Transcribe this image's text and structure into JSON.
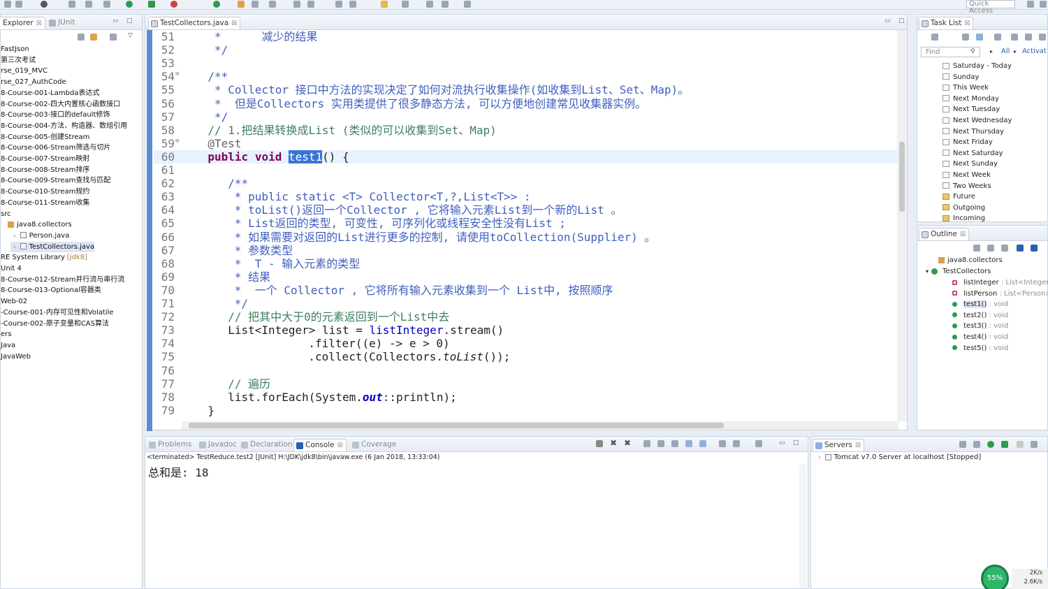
{
  "toolbar": {
    "quick_access": "Quick Access"
  },
  "explorer": {
    "tabs": [
      {
        "label": "Explorer",
        "close": "☒"
      },
      {
        "label": "JUnit"
      }
    ],
    "rows": [
      "FastJson",
      "第三次考试",
      "rse_019_MVC",
      "rse_027_AuthCode",
      "8-Course-001-Lambda表达式",
      "8-Course-002-四大内置核心函数接口",
      "8-Course-003-接口的default修饰",
      "8-Course-004-方法、构造器、数组引用",
      "8-Course-005-创建Stream",
      "8-Course-006-Stream筛选与切片",
      "8-Course-007-Stream映射",
      "8-Course-008-Stream排序",
      "8-Course-009-Stream查找与匹配",
      "8-Course-010-Stream规约",
      "8-Course-011-Stream收集",
      "src",
      "java8.collectors",
      "Person.java",
      "TestCollectors.java",
      "RE System Library",
      "Unit 4",
      "8-Course-012-Stream并行流与串行流",
      "8-Course-013-Optional容器类",
      "Web-02",
      "-Course-001-内存可见性和Volatile",
      "-Course-002-原子变量和CAS算法",
      "ers",
      "Java",
      "JavaWeb"
    ],
    "jdk_suffix": "[jdk8]"
  },
  "editor": {
    "tab_label": "TestCollectors.java",
    "tab_close": "☒",
    "lines": [
      {
        "n": "51",
        "t": "*      减少的结果",
        "cls": "jd",
        "ind": 0
      },
      {
        "n": "52",
        "t": "*/",
        "cls": "jd",
        "ind": 0
      },
      {
        "n": "53",
        "t": "",
        "cls": "",
        "ind": 0
      },
      {
        "n": "54",
        "t": "/**",
        "cls": "jd",
        "ind": -1
      },
      {
        "n": "55",
        "t": "* Collector 接口中方法的实现决定了如何对流执行收集操作(如收集到List、Set、Map)。",
        "cls": "jd",
        "ind": 0
      },
      {
        "n": "56",
        "t": "*  但是Collectors 实用类提供了很多静态方法, 可以方便地创建常见收集器实例。",
        "cls": "jd",
        "ind": 0
      },
      {
        "n": "57",
        "t": "*/",
        "cls": "jd",
        "ind": 0
      },
      {
        "n": "58",
        "t": "// 1.把结果转换成List (类似的可以收集到Set、Map)",
        "cls": "cm",
        "ind": -1
      },
      {
        "n": "59",
        "t": "@Test",
        "cls": "an",
        "ind": -1
      },
      {
        "n": "60",
        "t": "",
        "cls": "",
        "ind": -1
      },
      {
        "n": "61",
        "t": "",
        "cls": "",
        "ind": 0
      },
      {
        "n": "62",
        "t": "/**",
        "cls": "jd",
        "ind": 2
      },
      {
        "n": "63",
        "t": "* public static <T> Collector<T,?,List<T>> :",
        "cls": "jd",
        "ind": 3
      },
      {
        "n": "64",
        "t": "* toList()返回一个Collector , 它将输入元素List到一个新的List 。",
        "cls": "jd",
        "ind": 3
      },
      {
        "n": "65",
        "t": "* List返回的类型, 可变性, 可序列化或线程安全性没有List ;",
        "cls": "jd",
        "ind": 3
      },
      {
        "n": "66",
        "t": "* 如果需要对返回的List进行更多的控制, 请使用toCollection(Supplier) 。",
        "cls": "jd",
        "ind": 3
      },
      {
        "n": "67",
        "t": "* 参数类型",
        "cls": "jd",
        "ind": 3
      },
      {
        "n": "68",
        "t": "*  T - 输入元素的类型",
        "cls": "jd",
        "ind": 3
      },
      {
        "n": "69",
        "t": "* 结果",
        "cls": "jd",
        "ind": 3
      },
      {
        "n": "70",
        "t": "*  一个 Collector , 它将所有输入元素收集到一个 List中, 按照顺序",
        "cls": "jd",
        "ind": 3
      },
      {
        "n": "71",
        "t": "*/",
        "cls": "jd",
        "ind": 3
      },
      {
        "n": "72",
        "t": "// 把其中大于0的元素返回到一个List中去",
        "cls": "cm",
        "ind": 2
      },
      {
        "n": "73",
        "t": "",
        "cls": "",
        "ind": 2
      },
      {
        "n": "74",
        "t": ".filter((e) -> e > 0)",
        "cls": "",
        "ind": 14
      },
      {
        "n": "75",
        "t": "",
        "cls": "",
        "ind": 14
      },
      {
        "n": "76",
        "t": "",
        "cls": "",
        "ind": 0
      },
      {
        "n": "77",
        "t": "// 遍历",
        "cls": "cm",
        "ind": 2
      },
      {
        "n": "78",
        "t": "",
        "cls": "",
        "ind": 2
      },
      {
        "n": "79",
        "t": "}",
        "cls": "",
        "ind": -1
      }
    ],
    "method_line": {
      "kw": "public void",
      "name": "test1",
      "rest": "() {"
    },
    "list_line": {
      "pre": "List<Integer> list = ",
      "fld": "listInteger",
      "post": ".stream()"
    },
    "collect_line": {
      "pre": ".collect(Collectors.",
      "it": "toList",
      "post": "());"
    },
    "foreach_line": {
      "pre": "list.forEach(System.",
      "fld": "out",
      "post": "::println);"
    }
  },
  "tasklist": {
    "tab_label": "Task List",
    "find_placeholder": "Find",
    "all_label": "All",
    "activate_label": "Activat",
    "rows": [
      "Saturday - Today",
      "Sunday",
      "This Week",
      "Next Monday",
      "Next Tuesday",
      "Next Wednesday",
      "Next Thursday",
      "Next Friday",
      "Next Saturday",
      "Next Sunday",
      "Next Week",
      "Two Weeks",
      "Future",
      "Outgoing",
      "Incoming"
    ]
  },
  "outline": {
    "tab_label": "Outline",
    "package": "java8.collectors",
    "class_name": "TestCollectors",
    "members": [
      {
        "name": "listInteger",
        "type": " : List<Integer>",
        "vis": "private",
        "color": "#c8506a"
      },
      {
        "name": "listPerson",
        "type": " : List<Person>",
        "vis": "private",
        "color": "#c8506a"
      },
      {
        "name": "test1()",
        "type": " : void",
        "vis": "public",
        "color": "#2e9a4a"
      },
      {
        "name": "test2()",
        "type": " : void",
        "vis": "public",
        "color": "#2e9a4a"
      },
      {
        "name": "test3()",
        "type": " : void",
        "vis": "public",
        "color": "#2e9a4a"
      },
      {
        "name": "test4()",
        "type": " : void",
        "vis": "public",
        "color": "#2e9a4a"
      },
      {
        "name": "test5()",
        "type": " : void",
        "vis": "public",
        "color": "#2e9a4a"
      }
    ]
  },
  "console": {
    "tabs": [
      "Problems",
      "Javadoc",
      "Declaration",
      "Console",
      "Coverage"
    ],
    "header": "<terminated> TestReduce.test2 [JUnit] H:\\JDK\\jdk8\\bin\\javaw.exe (6 Jan 2018, 13:33:04)",
    "output": "总和是: 18"
  },
  "servers": {
    "tab_label": "Servers",
    "row": "Tomcat v7.0 Server at localhost  [Stopped]"
  },
  "net": {
    "percent": "55%",
    "up": "2K/s",
    "down": "2.6K/s"
  },
  "colors": {
    "accent": "#3875d7",
    "gutter": "#5b8bd0",
    "comment": "#3f7f5f",
    "javadoc": "#3f5fbf",
    "keyword": "#7f0055"
  }
}
